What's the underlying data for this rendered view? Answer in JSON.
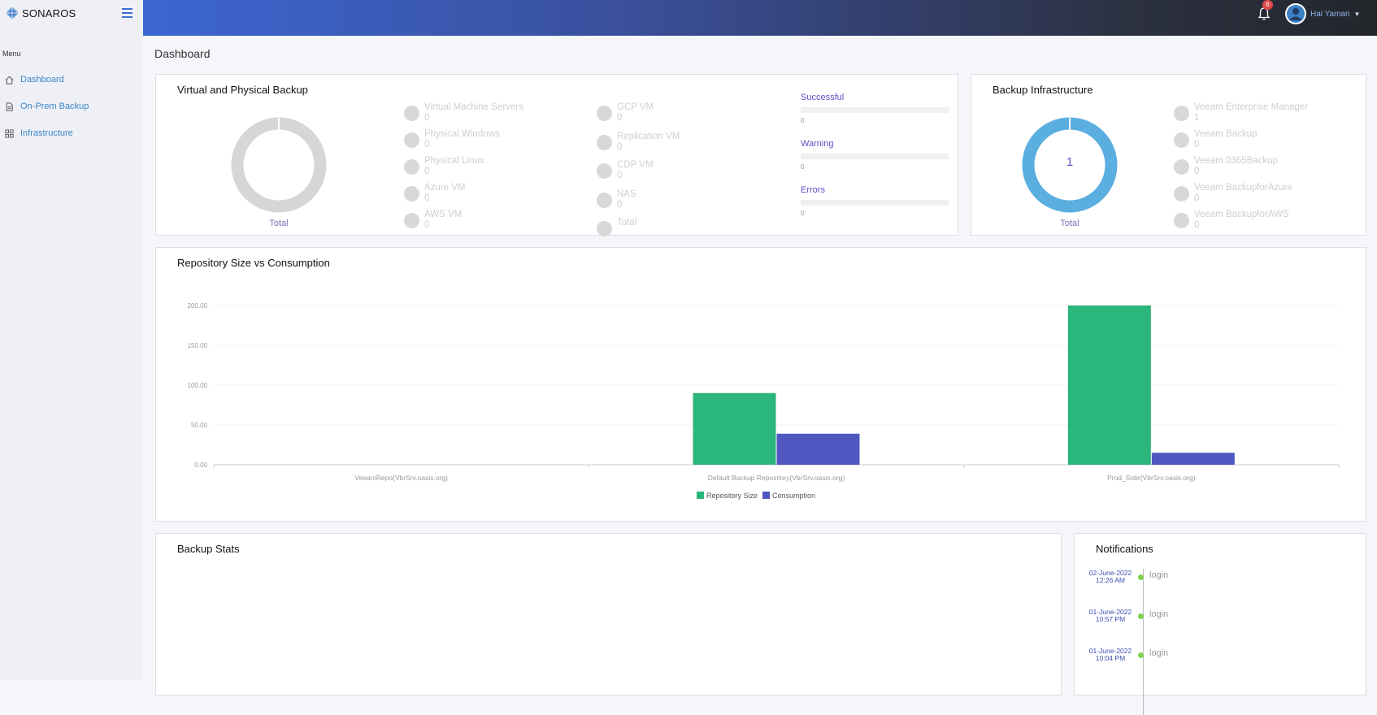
{
  "app": {
    "brand": "SONAROS"
  },
  "sidebar": {
    "menu_label": "Menu",
    "items": [
      {
        "label": "Dashboard",
        "icon": "home-icon"
      },
      {
        "label": "On-Prem Backup",
        "icon": "document-icon"
      },
      {
        "label": "Infrastructure",
        "icon": "grid-icon"
      }
    ]
  },
  "topbar": {
    "notification_count": "6",
    "user_name": "Hai Yaman"
  },
  "page": {
    "title": "Dashboard"
  },
  "vpb": {
    "title": "Virtual and Physical Backup",
    "donut_label": "Total",
    "legend_col1": [
      {
        "name": "Virtual Machine Servers",
        "value": "0"
      },
      {
        "name": "Physical Windows",
        "value": "0"
      },
      {
        "name": "Physical Linux",
        "value": "0"
      },
      {
        "name": "Azure VM",
        "value": "0"
      },
      {
        "name": "AWS VM",
        "value": "0"
      }
    ],
    "legend_col2": [
      {
        "name": "GCP VM",
        "value": "0"
      },
      {
        "name": "Replication VM",
        "value": "0"
      },
      {
        "name": "CDP VM",
        "value": "0"
      },
      {
        "name": "NAS",
        "value": "0"
      },
      {
        "name": "Total",
        "value": ""
      }
    ],
    "stats": [
      {
        "name": "Successful",
        "value": "0"
      },
      {
        "name": "Warning",
        "value": "0"
      },
      {
        "name": "Errors",
        "value": "0"
      }
    ]
  },
  "infra": {
    "title": "Backup Infrastructure",
    "donut_value": "1",
    "donut_label": "Total",
    "donut_color": "#5aaee0",
    "legend": [
      {
        "name": "Veeam Enterprise Manager",
        "value": "1"
      },
      {
        "name": "Veeam Backup",
        "value": "0"
      },
      {
        "name": "Veeam 0365Backup",
        "value": "0"
      },
      {
        "name": "Veeam BackupforAzure",
        "value": "0"
      },
      {
        "name": "Veeam BackupforAWS",
        "value": "0"
      }
    ]
  },
  "repo": {
    "title": "Repository Size vs Consumption"
  },
  "chart_data": {
    "type": "bar",
    "title": "Repository Size vs Consumption",
    "categories": [
      "VeeamRepo(VbrSrv.oasis.org)",
      "Default Backup Repository(VbrSrv.oasis.org)",
      "Prod_Sobr(VbrSrv.oasis.org)"
    ],
    "series": [
      {
        "name": "Repository Size",
        "color": "#2bb67b",
        "values": [
          0,
          90,
          200
        ]
      },
      {
        "name": "Consumption",
        "color": "#5157c1",
        "values": [
          0,
          39,
          15
        ]
      }
    ],
    "yticks": [
      "0.00",
      "50.00",
      "100.00",
      "150.00",
      "200.00"
    ],
    "ylim": [
      0,
      200
    ],
    "grid": true,
    "legend": "bottom"
  },
  "backup_stats": {
    "title": "Backup Stats"
  },
  "notifications": {
    "title": "Notifications",
    "items": [
      {
        "date": "02-June-2022",
        "time": "12:26 AM",
        "text": "login"
      },
      {
        "date": "01-June-2022",
        "time": "10:57 PM",
        "text": "login"
      },
      {
        "date": "01-June-2022",
        "time": "10:04 PM",
        "text": "login"
      }
    ]
  }
}
